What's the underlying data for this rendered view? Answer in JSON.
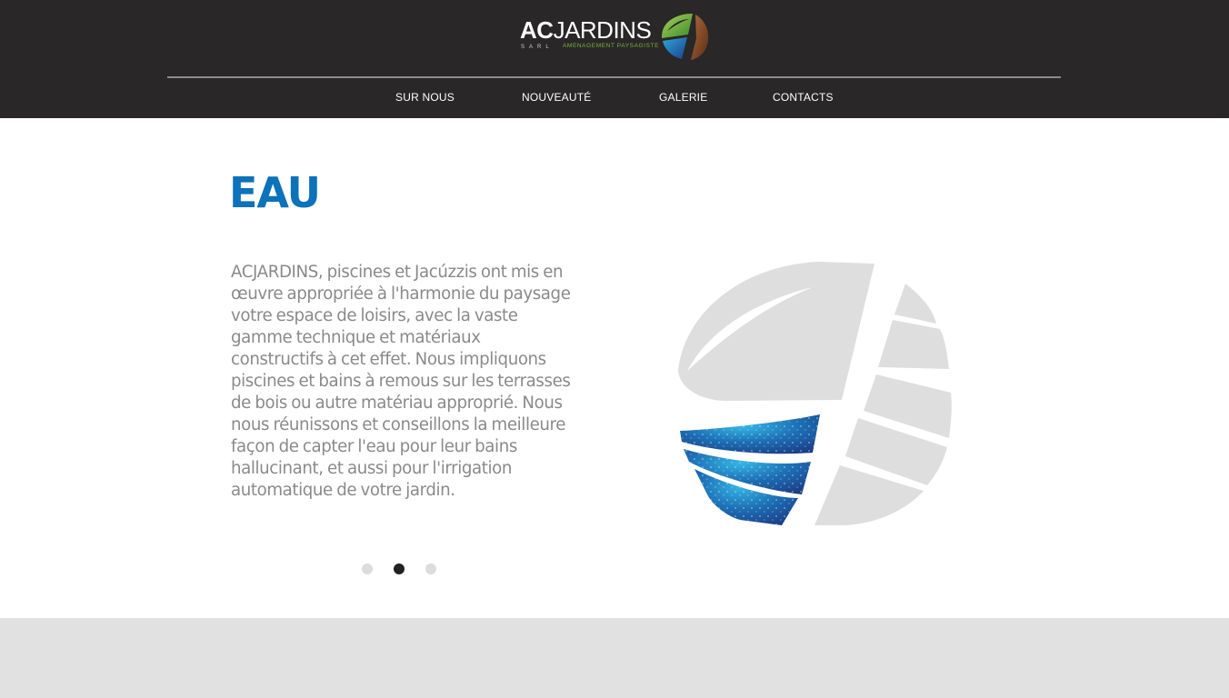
{
  "brand": {
    "name_ac": "AC",
    "name_jardins": "JARDINS",
    "legal_form": "SARL",
    "tagline": "AMENAGEMENT PAYSAGISTE"
  },
  "nav": {
    "items": [
      {
        "label": "SUR NOUS"
      },
      {
        "label": "NOUVEAUTÉ"
      },
      {
        "label": "GALERIE"
      },
      {
        "label": "CONTACTS"
      }
    ]
  },
  "slide": {
    "title": "EAU",
    "description": "ACJARDINS, piscines et Jacúzzis ont mis en œuvre appropriée à l'harmonie du paysage votre espace de loisirs, avec la vaste gamme technique et matériaux constructifs à cet effet. Nous impliquons piscines et bains à remous sur les terrasses de bois ou autre matériau approprié. Nous nous réunissons et conseillons la meilleure façon de capter l'eau pour leur bains hallucinant, et aussi pour l'irrigation automatique de votre jardin.",
    "current_index": 2,
    "total": 3,
    "emblem_icon": "leaf-wood-water-emblem-icon"
  },
  "colors": {
    "header_bg": "#292728",
    "title_blue": "#0c72b9",
    "text_gray": "#8a8a8a",
    "leaf_green": "#79b535",
    "water_blue": "#1c5fa8",
    "footer_bg": "#e1e1e1"
  }
}
